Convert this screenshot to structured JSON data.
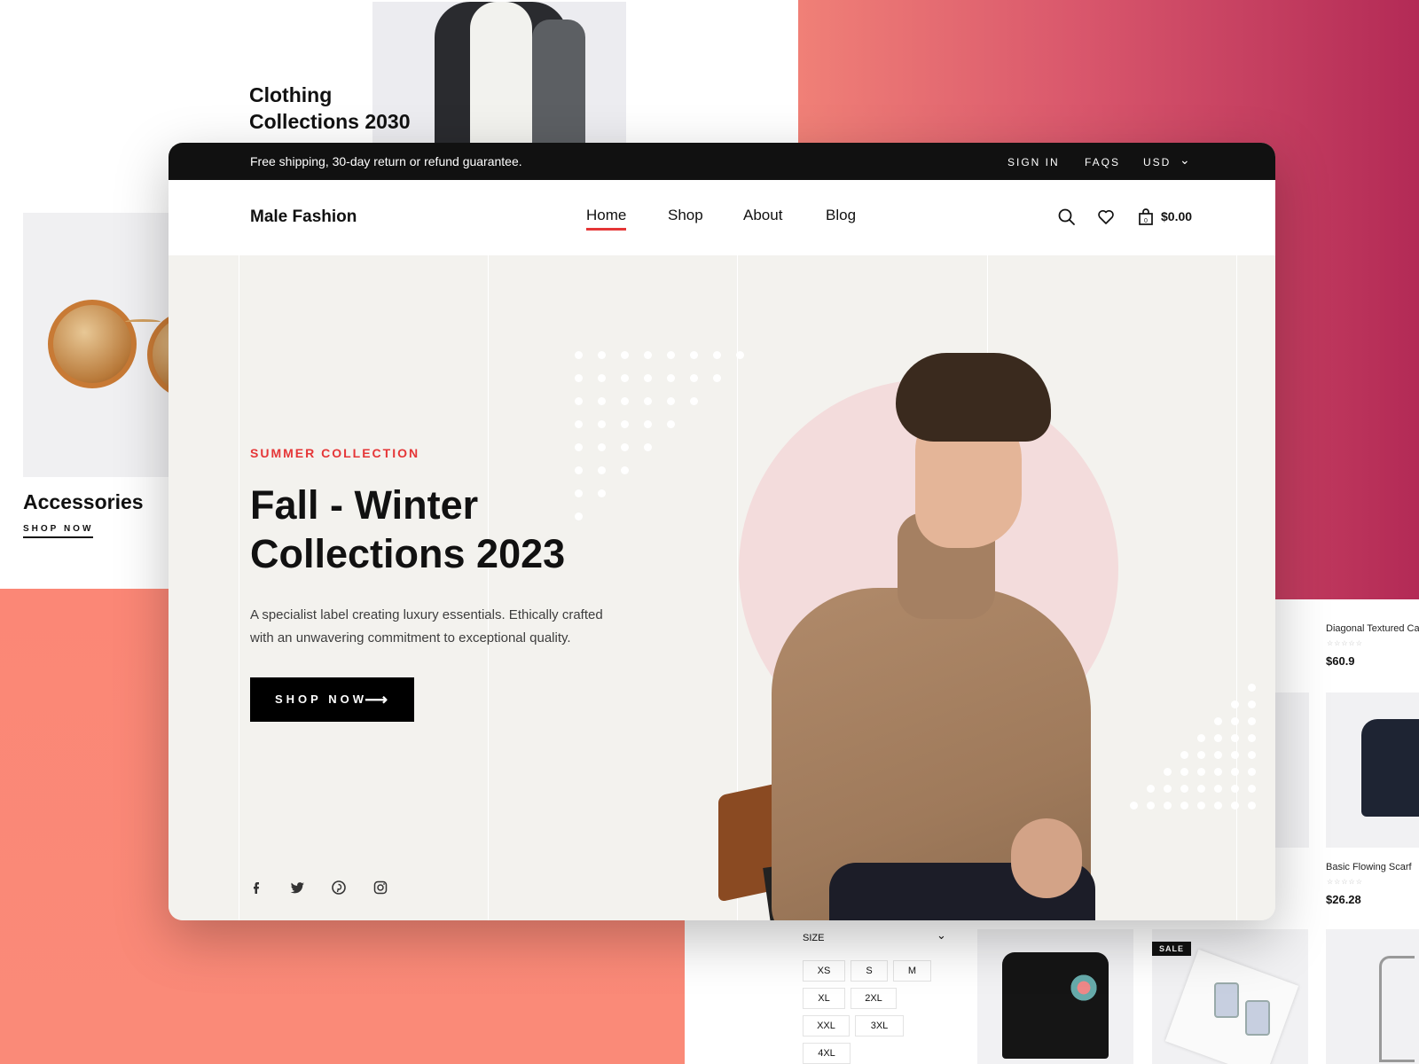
{
  "background": {
    "clothing_card": {
      "title": "Clothing Collections 2030"
    },
    "accessories_card": {
      "title": "Accessories",
      "link": "SHOP NOW"
    },
    "products": [
      {
        "name": "Diagonal Textured Cap",
        "stars": "☆☆☆☆☆",
        "price": "$60.9"
      },
      {
        "name": "Basic Flowing Scarf",
        "stars": "☆☆☆☆☆",
        "price": "$26.28"
      }
    ],
    "sale_badge": "SALE",
    "size_filter": {
      "label": "SIZE",
      "options": [
        "XS",
        "S",
        "M",
        "XL",
        "2XL",
        "XXL",
        "3XL",
        "4XL"
      ]
    }
  },
  "topbar": {
    "message": "Free shipping, 30-day return or refund guarantee.",
    "sign_in": "SIGN IN",
    "faqs": "FAQS",
    "currency": "USD"
  },
  "navbar": {
    "logo": "Male Fashion",
    "items": [
      {
        "label": "Home",
        "active": true
      },
      {
        "label": "Shop",
        "active": false
      },
      {
        "label": "About",
        "active": false
      },
      {
        "label": "Blog",
        "active": false
      }
    ],
    "cart_total": "$0.00",
    "cart_count": "0"
  },
  "hero": {
    "subtitle": "SUMMER COLLECTION",
    "title": "Fall - Winter Collections 2023",
    "description": "A specialist label creating luxury essentials. Ethically crafted with an unwavering commitment to exceptional quality.",
    "button": "SHOP NOW",
    "social": [
      "facebook-icon",
      "twitter-icon",
      "pinterest-icon",
      "instagram-icon"
    ]
  },
  "colors": {
    "accent": "#e53637",
    "topbar_bg": "#111111",
    "hero_bg": "#f3f2ee",
    "circle": "#f3dcdc"
  }
}
